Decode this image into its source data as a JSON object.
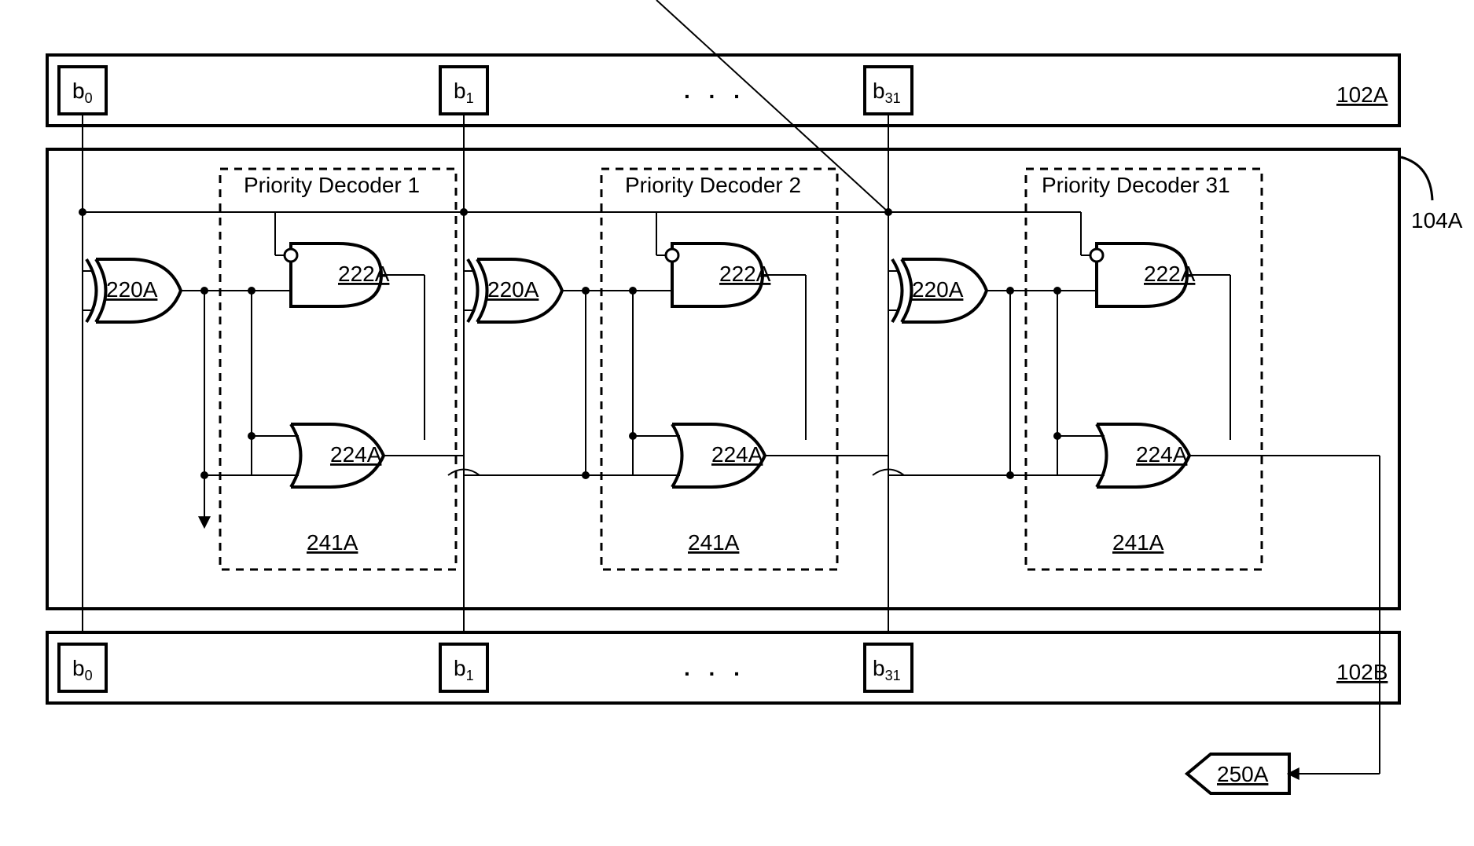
{
  "top_register": {
    "ref": "102A",
    "bits": [
      "b0",
      "b1",
      "b31"
    ],
    "ellipsis": ". . ."
  },
  "bottom_register": {
    "ref": "102B",
    "bits": [
      "b0",
      "b1",
      "b31"
    ],
    "ellipsis": ". . ."
  },
  "comparator_block": {
    "ref": "104A"
  },
  "decoders": [
    {
      "title": "Priority Decoder 1",
      "xor_ref": "220A",
      "and_ref": "222A",
      "or_ref": "224A",
      "block_ref": "241A"
    },
    {
      "title": "Priority Decoder 2",
      "xor_ref": "220A",
      "and_ref": "222A",
      "or_ref": "224A",
      "block_ref": "241A"
    },
    {
      "title": "Priority Decoder 31",
      "xor_ref": "220A",
      "and_ref": "222A",
      "or_ref": "224A",
      "block_ref": "241A"
    }
  ],
  "output_ref": "250A"
}
